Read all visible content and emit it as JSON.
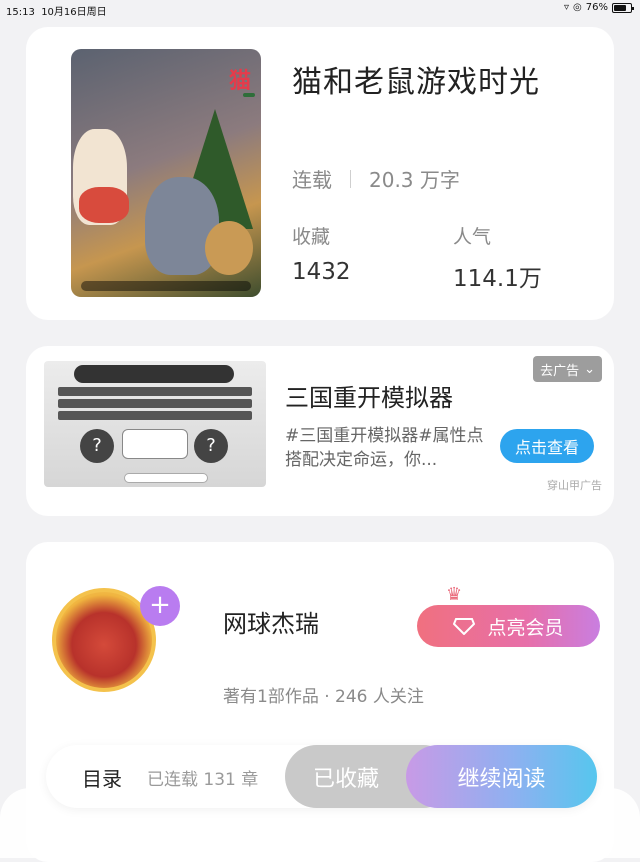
{
  "status_bar": {
    "time": "15:13",
    "date": "10月16日周日",
    "battery": "76%",
    "battery_level": 0.76
  },
  "book": {
    "title": "猫和老鼠游戏时光",
    "status": "连载",
    "word_count": "20.3 万字",
    "collect_label": "收藏",
    "collect_value": "1432",
    "popularity_label": "人气",
    "popularity_value": "114.1万",
    "cover_logo": "猫"
  },
  "ad": {
    "title": "三国重开模拟器",
    "desc": "#三国重开模拟器#属性点搭配决定命运，你...",
    "button_label": "点击查看",
    "remove_label": "去广告",
    "source": "穿山甲广告"
  },
  "author": {
    "name": "网球杰瑞",
    "meta": "著有1部作品 · 246 人关注",
    "vip_label": "点亮会员"
  },
  "bottom_bar": {
    "catalog_label": "目录",
    "chapters_label": "已连载 131 章",
    "collected_label": "已收藏",
    "continue_label": "继续阅读"
  },
  "colors": {
    "accent_blue": "#2da4ee",
    "vip_pink": "#f0707f",
    "add_purple": "#b97cf0"
  }
}
